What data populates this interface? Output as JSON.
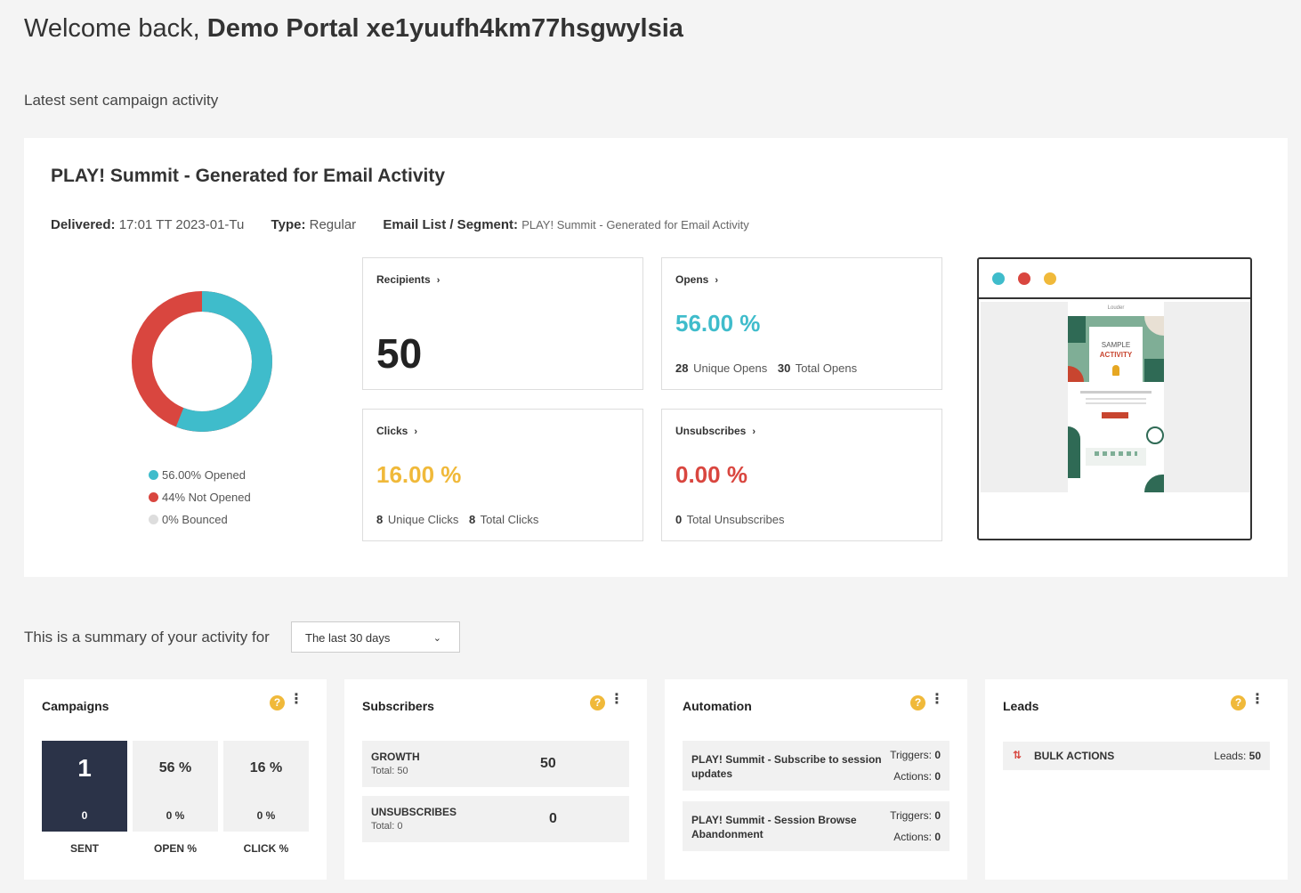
{
  "header": {
    "welcome_prefix": "Welcome back,",
    "portal_name": "Demo Portal xe1yuufh4km77hsgwylsia"
  },
  "latest_label": "Latest sent campaign activity",
  "campaign": {
    "title": "PLAY! Summit - Generated for Email Activity",
    "delivered_label": "Delivered:",
    "delivered_value": "17:01 TT 2023-01-Tu",
    "type_label": "Type:",
    "type_value": "Regular",
    "list_label": "Email List / Segment:",
    "list_value": "PLAY! Summit - Generated for Email Activity",
    "donut": {
      "opened_pct": 56,
      "not_opened_pct": 44,
      "bounced_pct": 0,
      "colors": {
        "opened": "#3fbccb",
        "not_opened": "#d9463f",
        "bounced": "#dddddd"
      }
    },
    "legend": [
      {
        "label": "56.00% Opened",
        "color": "#3fbccb"
      },
      {
        "label": "44% Not Opened",
        "color": "#d9463f"
      },
      {
        "label": "0% Bounced",
        "color": "#dddddd"
      }
    ],
    "recipients": {
      "label": "Recipients",
      "value": "50"
    },
    "opens": {
      "label": "Opens",
      "value": "56.00 %",
      "color": "#3fbccb",
      "unique": "28",
      "unique_label": "Unique Opens",
      "total": "30",
      "total_label": "Total Opens"
    },
    "clicks": {
      "label": "Clicks",
      "value": "16.00 %",
      "color": "#f0b93a",
      "unique": "8",
      "unique_label": "Unique Clicks",
      "total": "8",
      "total_label": "Total Clicks"
    },
    "unsubscribes": {
      "label": "Unsubscribes",
      "value": "0.00 %",
      "color": "#d9463f",
      "total": "0",
      "total_label": "Total Unsubscribes"
    },
    "preview": {
      "dot_colors": [
        "#3fbccb",
        "#d9463f",
        "#f0b93a"
      ],
      "email_brand": "Louder",
      "email_headline_1": "SAMPLE",
      "email_headline_2": "ACTIVITY"
    }
  },
  "summary": {
    "label": "This is a summary of your activity for",
    "period": "The last 30 days"
  },
  "campaigns_widget": {
    "title": "Campaigns",
    "boxes": [
      {
        "top": "1",
        "bottom": "0",
        "label": "SENT"
      },
      {
        "top": "56 %",
        "bottom": "0 %",
        "label": "OPEN %"
      },
      {
        "top": "16 %",
        "bottom": "0 %",
        "label": "CLICK %"
      }
    ]
  },
  "subscribers_widget": {
    "title": "Subscribers",
    "rows": [
      {
        "name": "GROWTH",
        "total": "Total: 50",
        "value": "50"
      },
      {
        "name": "UNSUBSCRIBES",
        "total": "Total: 0",
        "value": "0"
      }
    ]
  },
  "automation_widget": {
    "title": "Automation",
    "rows": [
      {
        "name": "PLAY! Summit - Subscribe to session updates",
        "triggers_label": "Triggers:",
        "triggers": "0",
        "actions_label": "Actions:",
        "actions": "0"
      },
      {
        "name": "PLAY! Summit - Session Browse Abandonment",
        "triggers_label": "Triggers:",
        "triggers": "0",
        "actions_label": "Actions:",
        "actions": "0"
      }
    ]
  },
  "leads_widget": {
    "title": "Leads",
    "row": {
      "name": "BULK ACTIONS",
      "count_label": "Leads:",
      "count": "50"
    }
  },
  "icons": {
    "help": "?",
    "kebab": "⋮",
    "chevron_right": "›",
    "chevron_down": "⌄",
    "sort": "⇅"
  }
}
